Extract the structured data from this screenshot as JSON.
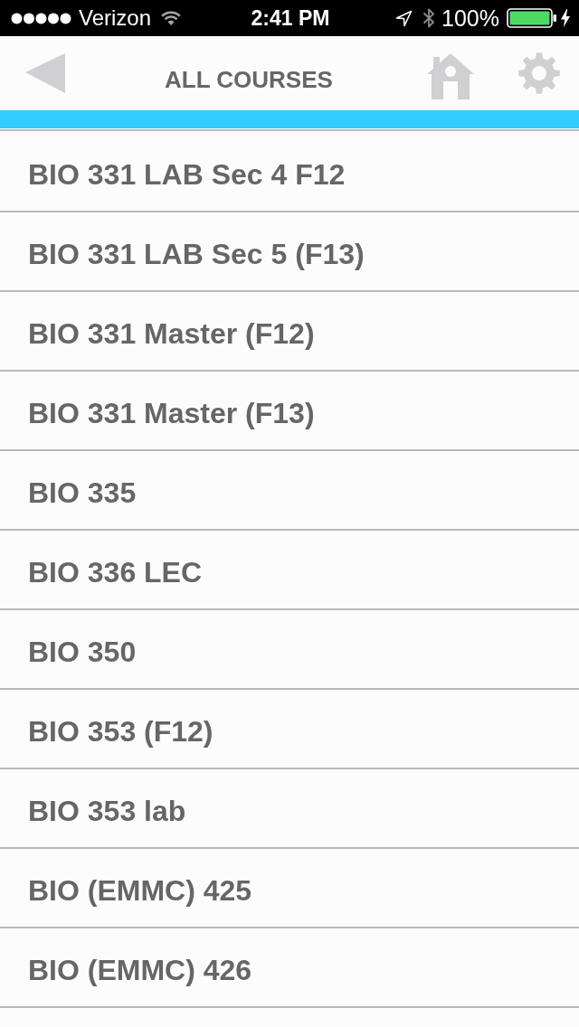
{
  "status_bar": {
    "carrier": "Verizon",
    "time": "2:41 PM",
    "battery": "100%"
  },
  "header": {
    "title": "ALL COURSES"
  },
  "courses": [
    {
      "name": "BIO 331 LAB Sec 4 F12"
    },
    {
      "name": "BIO 331 LAB Sec 5 (F13)"
    },
    {
      "name": "BIO 331 Master (F12)"
    },
    {
      "name": "BIO 331 Master (F13)"
    },
    {
      "name": "BIO 335"
    },
    {
      "name": "BIO 336 LEC"
    },
    {
      "name": "BIO 350"
    },
    {
      "name": "BIO 353 (F12)"
    },
    {
      "name": "BIO 353 lab"
    },
    {
      "name": "BIO (EMMC) 425"
    },
    {
      "name": "BIO (EMMC) 426"
    }
  ]
}
